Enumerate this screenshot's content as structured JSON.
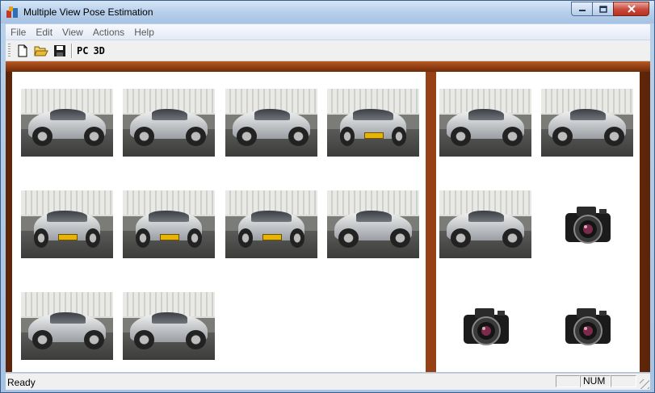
{
  "window": {
    "title": "Multiple View Pose Estimation"
  },
  "menu": {
    "items": [
      "File",
      "Edit",
      "View",
      "Actions",
      "Help"
    ]
  },
  "toolbar": {
    "new_icon": "new-document-icon",
    "open_icon": "open-folder-icon",
    "save_icon": "save-disk-icon",
    "pc_label": "PC",
    "three_d_label": "3D"
  },
  "left_pane": {
    "images": [
      {
        "view": "side"
      },
      {
        "view": "side"
      },
      {
        "view": "side"
      },
      {
        "view": "front"
      },
      {
        "view": "front"
      },
      {
        "view": "front"
      },
      {
        "view": "front"
      },
      {
        "view": "side"
      },
      {
        "view": "side"
      },
      {
        "view": "side"
      }
    ]
  },
  "right_pane": {
    "images": [
      {
        "kind": "photo",
        "view": "side"
      },
      {
        "kind": "photo",
        "view": "side"
      },
      {
        "kind": "photo",
        "view": "side"
      },
      {
        "kind": "camera"
      },
      {
        "kind": "camera"
      },
      {
        "kind": "camera"
      }
    ]
  },
  "status": {
    "text": "Ready",
    "num": "NUM"
  },
  "colors": {
    "frame_wood": "#8b3a12",
    "title_bar": "#b7cfea",
    "close_button": "#c7493b",
    "plate": "#e8b400"
  }
}
